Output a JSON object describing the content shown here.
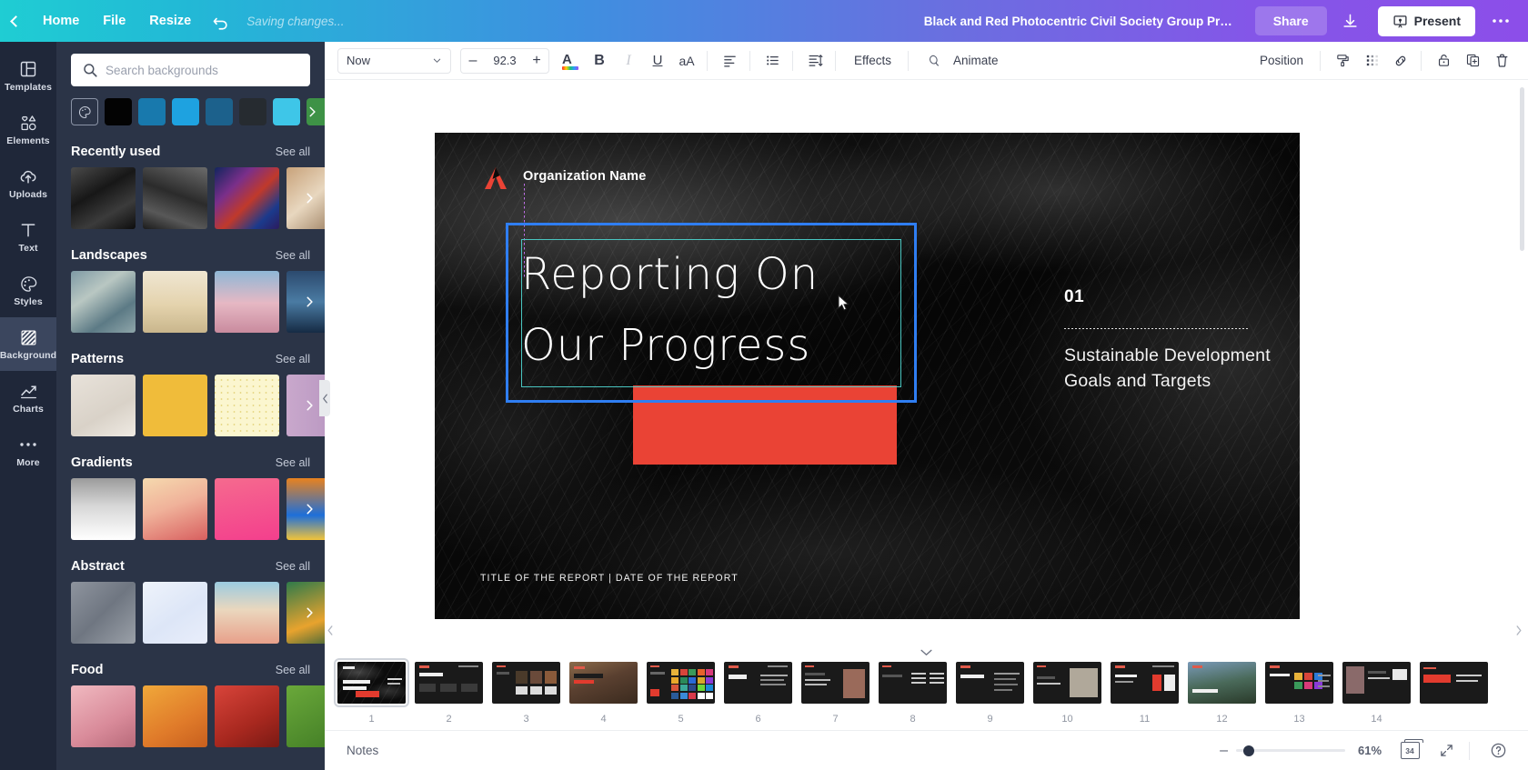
{
  "topbar": {
    "back_icon": "chevron-left-icon",
    "home_label": "Home",
    "file_label": "File",
    "resize_label": "Resize",
    "undo_icon": "undo-arrow-icon",
    "status_text": "Saving changes...",
    "doc_title": "Black and Red Photocentric Civil Society Group Progress Re...",
    "share_label": "Share",
    "download_icon": "download-icon",
    "present_label": "Present",
    "present_icon": "present-screen-icon",
    "more_icon": "more-horizontal-icon"
  },
  "rail": {
    "items": [
      {
        "label": "Templates",
        "icon": "templates-grid-icon",
        "active": false
      },
      {
        "label": "Elements",
        "icon": "shapes-icon",
        "active": false
      },
      {
        "label": "Uploads",
        "icon": "cloud-upload-icon",
        "active": false
      },
      {
        "label": "Text",
        "icon": "text-T-icon",
        "active": false
      },
      {
        "label": "Styles",
        "icon": "palette-icon",
        "active": false
      },
      {
        "label": "Background",
        "icon": "hatch-pattern-icon",
        "active": true
      },
      {
        "label": "Charts",
        "icon": "line-chart-icon",
        "active": false
      },
      {
        "label": "More",
        "icon": "ellipsis-icon",
        "active": false
      }
    ]
  },
  "panel": {
    "search_placeholder": "Search backgrounds",
    "search_value": "",
    "search_icon": "search-icon",
    "color_picker_icon": "color-palette-icon",
    "swatches": [
      "#030303",
      "#1879ad",
      "#1ea2e0",
      "#1c618c",
      "#262b30",
      "#3ec6e8",
      "#3e9246"
    ],
    "swatch_more_icon": "chevron-right-icon",
    "see_all_label": "See all",
    "sections": [
      {
        "title": "Recently used",
        "thumbs": [
          {
            "name": "dark-marble-texture",
            "css": "linear-gradient(150deg,#4a4a4a 0%,#171717 40%,#3b3b3b 70%,#0d0d0d 100%)"
          },
          {
            "name": "grey-stone-texture",
            "css": "linear-gradient(200deg,#6b6b6b 0%,#2b2b2b 45%,#585858 75%,#1b1b1b 100%)"
          },
          {
            "name": "city-lights-bokeh",
            "css": "linear-gradient(135deg,#12255e 0%,#7a2f8a 30%,#c0392b 55%,#1b3a8c 80%,#2b1b5e 100%)"
          },
          {
            "name": "warm-blur-photo",
            "css": "linear-gradient(140deg,#c8a27a 0%,#e8d7bf 45%,#8a6a4a 100%)"
          }
        ]
      },
      {
        "title": "Landscapes",
        "thumbs": [
          {
            "name": "pebble-beach-stones",
            "css": "linear-gradient(145deg,#7e9aa5 0%,#b9c7c2 35%,#5c7a85 70%,#8fa6aa 100%)"
          },
          {
            "name": "desert-dune-horizon",
            "css": "linear-gradient(180deg,#efe6d2 0%,#e4d3ad 55%,#c9b68c 100%)"
          },
          {
            "name": "pink-mountain-sunset",
            "css": "linear-gradient(180deg,#8fb7d6 0%,#e6b8c4 52%,#c98b9e 100%)"
          },
          {
            "name": "blue-mountain-range",
            "css": "linear-gradient(180deg,#2c4a6e 0%,#4a7ba3 50%,#162b44 100%)"
          }
        ]
      },
      {
        "title": "Patterns",
        "thumbs": [
          {
            "name": "beige-plaster-texture",
            "css": "linear-gradient(150deg,#e8e2da 0%,#d9d2c8 60%,#efeae3 100%)"
          },
          {
            "name": "solid-yellow",
            "css": "linear-gradient(0deg,#f0bc3a,#f0bc3a)"
          },
          {
            "name": "cream-dot-pattern",
            "css": "linear-gradient(0deg,#fbf6cf,#fbf6cf)"
          },
          {
            "name": "purple-stripe-pattern",
            "css": "linear-gradient(90deg,#c9a8cc 0%,#b391bd 100%)"
          }
        ]
      },
      {
        "title": "Gradients",
        "thumbs": [
          {
            "name": "grey-white-gradient",
            "css": "linear-gradient(180deg,#9b9b9b 0%,#d7d7d7 45%,#ffffff 100%)"
          },
          {
            "name": "peach-sunset-gradient",
            "css": "linear-gradient(160deg,#f5d9ae 0%,#f0b29a 45%,#d85f5f 100%)"
          },
          {
            "name": "pink-magenta-gradient",
            "css": "linear-gradient(170deg,#f56a8e 0%,#f43f8d 100%)"
          },
          {
            "name": "orange-blue-gradient",
            "css": "linear-gradient(180deg,#e8821e 0%,#1e6fd9 60%,#f2c43a 100%)"
          }
        ]
      },
      {
        "title": "Abstract",
        "thumbs": [
          {
            "name": "grey-geometric-shards",
            "css": "linear-gradient(135deg,#8e949e 0%,#6f7681 50%,#9aa0a8 100%)"
          },
          {
            "name": "pale-blue-triangles",
            "css": "linear-gradient(145deg,#eef3fb 0%,#dde6f7 55%,#e9eefb 100%)"
          },
          {
            "name": "desert-road-illustration",
            "css": "linear-gradient(180deg,#9ccbe0 0%,#ead7be 45%,#e8a08a 100%)"
          },
          {
            "name": "green-orange-abstract",
            "css": "linear-gradient(160deg,#2f7a4a 0%,#e8a32e 60%,#1f5a3a 100%)"
          }
        ]
      },
      {
        "title": "Food",
        "thumbs": [
          {
            "name": "pink-dessert-photo",
            "css": "linear-gradient(150deg,#f0b9c0 0%,#d98b9a 60%,#b86a7a 100%)"
          },
          {
            "name": "orange-fruit-photo",
            "css": "linear-gradient(150deg,#f0a83a 0%,#e07b2a 60%,#c75f1e 100%)"
          },
          {
            "name": "red-berries-photo",
            "css": "linear-gradient(150deg,#d8443a 0%,#a8281f 60%,#7a1a14 100%)"
          },
          {
            "name": "green-salad-photo",
            "css": "linear-gradient(150deg,#6aa83a 0%,#3f7a24 100%)"
          }
        ]
      }
    ]
  },
  "toolbar": {
    "font_name": "Now",
    "font_dropdown_icon": "chevron-down-icon",
    "font_size_minus": "–",
    "font_size": "92.3",
    "font_size_plus": "+",
    "text_color_icon": "text-color-A-icon",
    "bold_label": "B",
    "italic_label": "I",
    "underline_label": "U",
    "case_label": "aA",
    "align_icon": "align-left-icon",
    "list_icon": "bullet-list-icon",
    "spacing_icon": "line-spacing-icon",
    "effects_label": "Effects",
    "animate_label": "Animate",
    "animate_icon": "animate-icon",
    "position_label": "Position",
    "brush_icon": "paint-roller-icon",
    "transparency_icon": "transparency-icon",
    "link_icon": "link-icon",
    "lock_icon": "lock-icon",
    "duplicate_icon": "duplicate-icon",
    "delete_icon": "trash-icon"
  },
  "slide": {
    "logo_icon": "organization-logo-mark",
    "org_name": "Organization Name",
    "title_line1": "Reporting On",
    "title_line2": "Our  Progress",
    "section_number": "01",
    "section_text": "Sustainable Development Goals and Targets",
    "footer": "TITLE OF THE REPORT  |  DATE OF THE REPORT",
    "accent_color": "#ea4335",
    "selection_color": "#2f7ef2",
    "guide_color": "#49c5c0"
  },
  "filmstrip": {
    "collapse_icon": "chevron-down-icon",
    "scroll_left_icon": "chevron-left-icon",
    "scroll_right_icon": "chevron-right-icon",
    "slides": [
      {
        "num": "1",
        "kind": "dark-marble-title",
        "selected": true
      },
      {
        "num": "2",
        "kind": "dark-three-col",
        "selected": false
      },
      {
        "num": "3",
        "kind": "white-photo-grid",
        "selected": false
      },
      {
        "num": "4",
        "kind": "dark-photo-bear",
        "selected": false
      },
      {
        "num": "5",
        "kind": "white-color-grid",
        "selected": false
      },
      {
        "num": "6",
        "kind": "dark-objective",
        "selected": false
      },
      {
        "num": "7",
        "kind": "white-portrait",
        "selected": false
      },
      {
        "num": "8",
        "kind": "white-text-cols",
        "selected": false
      },
      {
        "num": "9",
        "kind": "dark-agenda",
        "selected": false
      },
      {
        "num": "10",
        "kind": "white-photo-right",
        "selected": false
      },
      {
        "num": "11",
        "kind": "dark-report",
        "selected": false
      },
      {
        "num": "12",
        "kind": "photo-landscape",
        "selected": false
      },
      {
        "num": "13",
        "kind": "dark-colorblocks",
        "selected": false
      },
      {
        "num": "14",
        "kind": "white-person",
        "selected": false
      }
    ]
  },
  "bottombar": {
    "notes_label": "Notes",
    "zoom_minus": "–",
    "zoom_percent": "61%",
    "page_count": "34",
    "pages_icon": "pages-stack-icon",
    "fullscreen_icon": "expand-arrows-icon",
    "help_icon": "help-question-icon"
  }
}
